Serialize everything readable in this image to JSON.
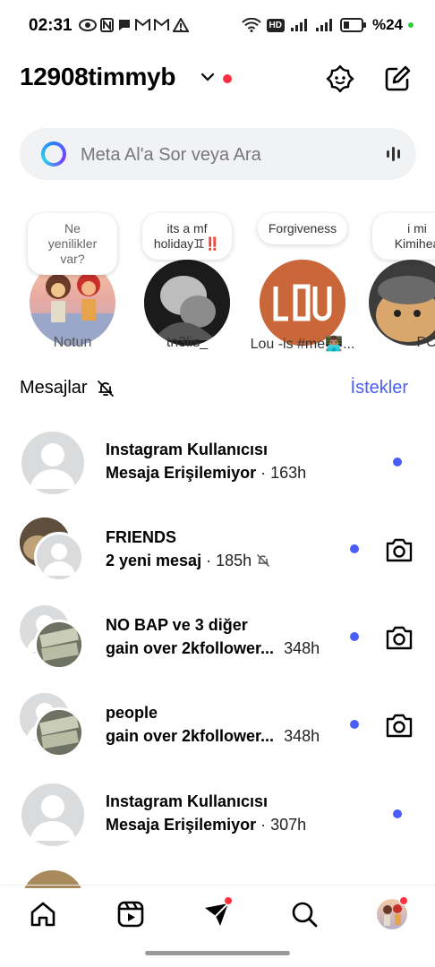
{
  "status_bar": {
    "time": "02:31",
    "left_icons": [
      "eye-icon",
      "nfc-icon",
      "chat-icon",
      "gmail-icon",
      "gmail-icon",
      "warning-icon"
    ],
    "hd_label": "HD",
    "battery_text": "%24"
  },
  "header": {
    "username": "12908timmyb",
    "icons": [
      "meta-ai-icon",
      "new-message-icon"
    ]
  },
  "search": {
    "placeholder": "Meta Al'a Sor veya Ara"
  },
  "notes": [
    {
      "bubble": "Ne yenilikler\nvar?",
      "name": "Notun"
    },
    {
      "bubble": "its a mf\nholiday♊‼️",
      "name": "tn3lis_"
    },
    {
      "bubble": "Forgiveness",
      "name": "Lou -is  #me👨🏽‍💻..."
    },
    {
      "bubble": "i mi\nKimihea",
      "name": "PO"
    }
  ],
  "messages_header": {
    "title": "Mesajlar",
    "requests": "İstekler"
  },
  "messages": [
    {
      "title": "Instagram Kullanıcısı",
      "subtitle": "Mesaja Erişilemiyor",
      "separator": "·",
      "time": "163h",
      "muted": false,
      "camera": false,
      "avatar": "single"
    },
    {
      "title": "FRIENDS",
      "subtitle": "2 yeni mesaj",
      "separator": "·",
      "time": "185h",
      "muted": true,
      "camera": true,
      "avatar": "group"
    },
    {
      "title": "NO BAP ve 3 diğer",
      "subtitle": "gain over 2kfollower...",
      "separator": "",
      "time": "348h",
      "muted": false,
      "camera": true,
      "avatar": "group"
    },
    {
      "title": "people",
      "subtitle": "gain over 2kfollower...",
      "separator": "",
      "time": "348h",
      "muted": false,
      "camera": true,
      "avatar": "group"
    },
    {
      "title": "Instagram Kullanıcısı",
      "subtitle": "Mesaja Erişilemiyor",
      "separator": "·",
      "time": "307h",
      "muted": false,
      "camera": false,
      "avatar": "single"
    }
  ],
  "bottom_nav": [
    "home-icon",
    "reels-icon",
    "direct-icon",
    "search-icon",
    "profile-avatar"
  ],
  "colors": {
    "accent": "#4a5df9",
    "notification": "#ff3040",
    "search_bg": "#f1f2f4"
  }
}
